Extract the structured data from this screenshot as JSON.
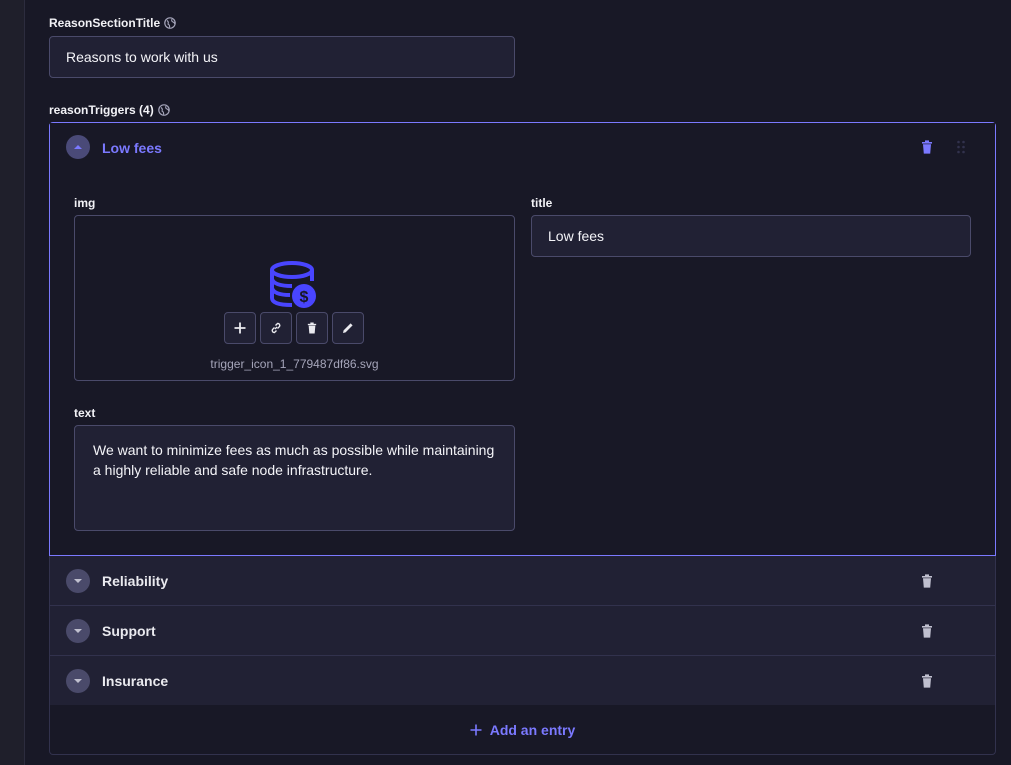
{
  "reason_section": {
    "label": "ReasonSectionTitle",
    "value": "Reasons to work with us"
  },
  "triggers": {
    "label": "reasonTriggers (4)",
    "open_item": {
      "title": "Low fees",
      "img_label": "img",
      "img_filename": "trigger_icon_1_779487df86.svg",
      "title_label": "title",
      "title_value": "Low fees",
      "text_label": "text",
      "text_value": "We want to minimize fees as much as possible while maintaining a highly reliable and safe node infrastructure."
    },
    "items": [
      {
        "title": "Reliability"
      },
      {
        "title": "Support"
      },
      {
        "title": "Insurance"
      }
    ],
    "add_label": "Add an entry"
  },
  "colors": {
    "accent": "#7b79ff",
    "background": "#181826",
    "panel": "#212134",
    "border": "#4a4a6a"
  }
}
